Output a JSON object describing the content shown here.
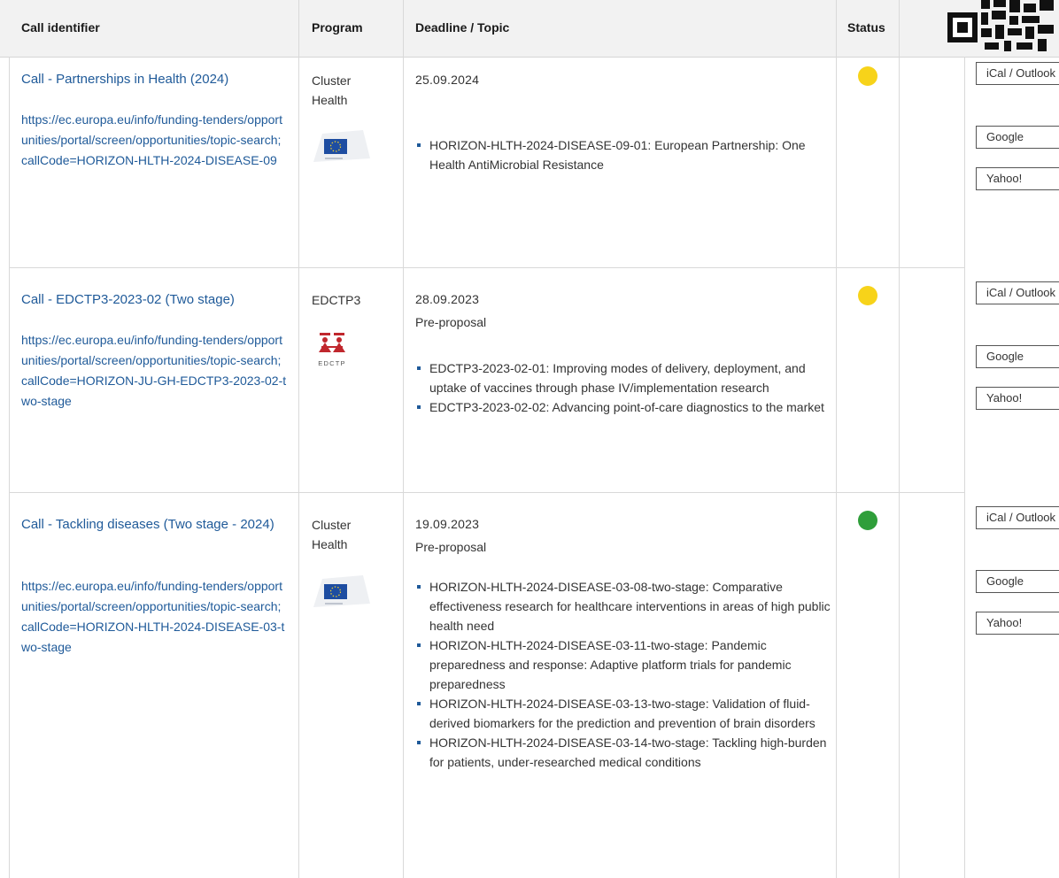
{
  "table": {
    "headers": {
      "call_identifier": "Call identifier",
      "program": "Program",
      "deadline_topic": "Deadline / Topic",
      "status": "Status"
    },
    "calendar_labels": {
      "ical": "iCal / Outlook",
      "google": "Google",
      "yahoo": "Yahoo!"
    },
    "status_colors": {
      "open": "#f7d31a",
      "forthcoming": "#2f9e3a"
    },
    "rows": [
      {
        "title": "Call - Partnerships in Health (2024)",
        "url": "https://ec.europa.eu/info/funding-tenders/opportunities/portal/screen/opportunities/topic-search;callCode=HORIZON-HLTH-2024-DISEASE-09",
        "program": "Cluster Health",
        "logo": "eu-commission-logo",
        "date": "25.09.2024",
        "subtitle": "",
        "topics": [
          "HORIZON-HLTH-2024-DISEASE-09-01: European Partnership: One Health AntiMicrobial Resistance"
        ],
        "status": "open"
      },
      {
        "title": "Call - EDCTP3-2023-02 (Two stage)",
        "url": "https://ec.europa.eu/info/funding-tenders/opportunities/portal/screen/opportunities/topic-search;callCode=HORIZON-JU-GH-EDCTP3-2023-02-two-stage",
        "program": "EDCTP3",
        "logo": "edctp-logo",
        "logo_text": "EDCTP",
        "date": "28.09.2023",
        "subtitle": "Pre-proposal",
        "topics": [
          "EDCTP3-2023-02-01: Improving modes of delivery, deployment, and uptake of vaccines through phase IV/implementation research",
          "EDCTP3-2023-02-02: Advancing point-of-care diagnostics to the market"
        ],
        "status": "open"
      },
      {
        "title": "Call - Tackling diseases (Two stage - 2024)",
        "url": "https://ec.europa.eu/info/funding-tenders/opportunities/portal/screen/opportunities/topic-search;callCode=HORIZON-HLTH-2024-DISEASE-03-two-stage",
        "program": "Cluster Health",
        "logo": "eu-commission-logo",
        "date": "19.09.2023",
        "subtitle": "Pre-proposal",
        "topics": [
          "HORIZON-HLTH-2024-DISEASE-03-08-two-stage: Comparative effectiveness research for healthcare interventions in areas of high public health need",
          "HORIZON-HLTH-2024-DISEASE-03-11-two-stage: Pandemic preparedness and response: Adaptive platform trials for pandemic preparedness",
          "HORIZON-HLTH-2024-DISEASE-03-13-two-stage: Validation of fluid-derived biomarkers for the prediction and prevention of brain disorders",
          "HORIZON-HLTH-2024-DISEASE-03-14-two-stage: Tackling high-burden for patients, under-researched medical conditions"
        ],
        "status": "forthcoming"
      }
    ]
  }
}
